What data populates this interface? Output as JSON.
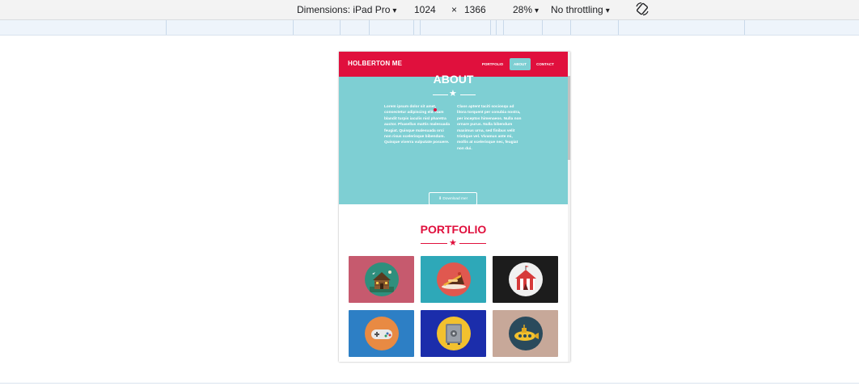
{
  "devtools": {
    "dimensions_label": "Dimensions: iPad Pro",
    "width": "1024",
    "times": "×",
    "height": "1366",
    "zoom": "28%",
    "throttling": "No throttling",
    "caret": "▾"
  },
  "site": {
    "brand": "HOLBERTON ME",
    "nav": [
      {
        "label": "PORTFOLIO",
        "active": false
      },
      {
        "label": "ABOUT",
        "active": true
      },
      {
        "label": "CONTACT",
        "active": false
      }
    ],
    "about": {
      "title": "ABOUT",
      "col1": "Lorem ipsum dolor sit amet, consectetur adipiscing elit. Nam blandit turpis iaculis nisl pharetra auctor. Phasellus mattis malesuada feugiat. Quisque malesuada orci non risus scelerisque bibendum. Quisque viverra vulputate posuere.",
      "col2": "Class aptent taciti sociosqu ad litora torquent per conubia nostra, per inceptos himenaeos. Nulla non ornare purus. Nulla bibendum maximus urna, sed finibus velit tristique vel. Vivamus ante mi, mollis at scelerisque nec, feugiat non dui.",
      "download_label": "Download me!"
    },
    "portfolio": {
      "title": "PORTFOLIO",
      "items": [
        {
          "name": "cabin",
          "bg": "#c65a6e",
          "circle": "#2f8f7d"
        },
        {
          "name": "cake",
          "bg": "#2ea8b8",
          "circle": "#e0584f"
        },
        {
          "name": "circus",
          "bg": "#1c1c1c",
          "circle": "#f0f0f0"
        },
        {
          "name": "gamepad",
          "bg": "#2d7fc5",
          "circle": "#e88a43"
        },
        {
          "name": "safe",
          "bg": "#1b2dab",
          "circle": "#f2c12e"
        },
        {
          "name": "submarine",
          "bg": "#c7a899",
          "circle": "#2a4a5c"
        }
      ]
    }
  },
  "colors": {
    "accent": "#e0103d",
    "teal": "#7ecfd3"
  }
}
